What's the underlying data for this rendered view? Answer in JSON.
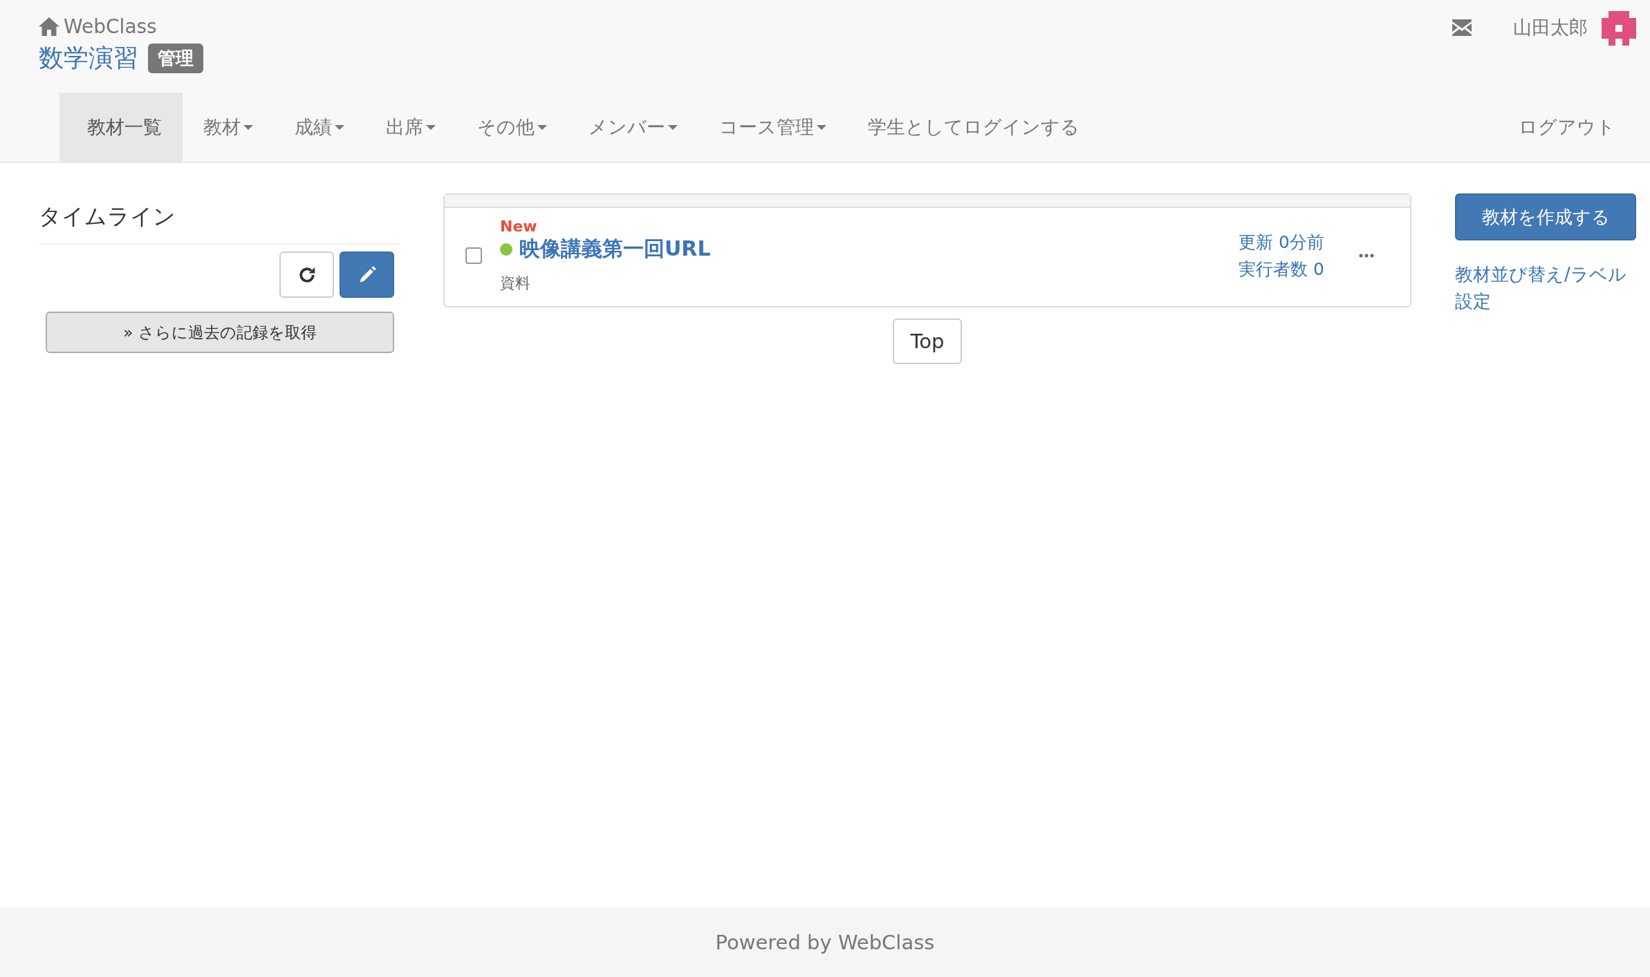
{
  "header": {
    "home_link": "WebClass",
    "course_title": "数学演習",
    "role_badge": "管理",
    "user_name": "山田太郎"
  },
  "nav": {
    "items": [
      {
        "label": "教材一覧",
        "dropdown": false,
        "selected": true
      },
      {
        "label": "教材",
        "dropdown": true,
        "selected": false
      },
      {
        "label": "成績",
        "dropdown": true,
        "selected": false
      },
      {
        "label": "出席",
        "dropdown": true,
        "selected": false
      },
      {
        "label": "その他",
        "dropdown": true,
        "selected": false
      },
      {
        "label": "メンバー",
        "dropdown": true,
        "selected": false
      },
      {
        "label": "コース管理",
        "dropdown": true,
        "selected": false
      },
      {
        "label": "学生としてログインする",
        "dropdown": false,
        "selected": false
      }
    ],
    "logout": "ログアウト"
  },
  "timeline": {
    "title": "タイムライン",
    "more_button": "» さらに過去の記録を取得"
  },
  "materials": [
    {
      "new_badge": "New",
      "title": "映像講義第一回URL",
      "type": "資料",
      "updated": "更新 0分前",
      "participants": "実行者数 0",
      "checked": false
    }
  ],
  "top_button": "Top",
  "actions": {
    "create_button": "教材を作成する",
    "reorder_link": "教材並び替え/ラベル設定"
  },
  "footer": "Powered by WebClass"
}
